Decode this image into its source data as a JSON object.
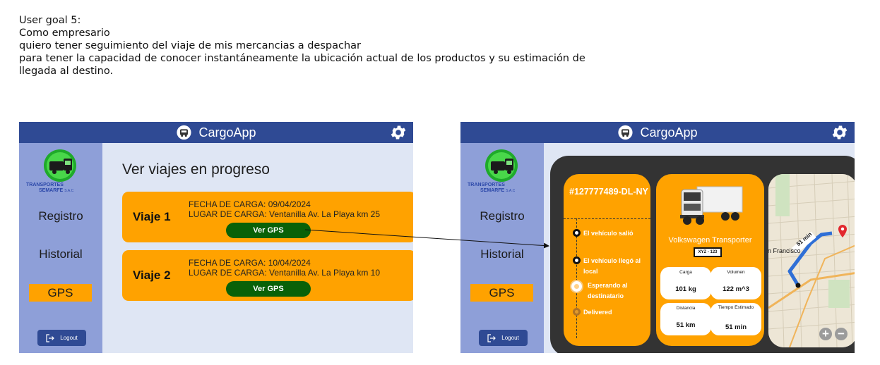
{
  "story": {
    "line1": "User goal 5:",
    "line2": "Como empresario",
    "line3": "quiero tener seguimiento del viaje de mis mercancias a despachar",
    "line4": "para tener la capacidad de conocer instantáneamente la ubicación actual de los productos y su estimación de",
    "line5": "llegada al destino."
  },
  "app": {
    "title": "CargoApp",
    "icon": "truck-icon",
    "settings_icon": "gear-icon"
  },
  "brand": {
    "name_top": "TRANSPORTES",
    "name_bottom": "SEMARFE",
    "suffix": "S.A.C"
  },
  "sidebar": {
    "items": [
      {
        "label": "Registro"
      },
      {
        "label": "Historial"
      },
      {
        "label": "GPS"
      }
    ],
    "logout_label": "Logout"
  },
  "list_screen": {
    "title": "Ver viajes en progreso",
    "trips": [
      {
        "name": "Viaje 1",
        "date_line": "FECHA DE CARGA: 09/04/2024",
        "place_line": "LUGAR DE CARGA: Ventanilla Av. La Playa km 25",
        "button": "Ver GPS"
      },
      {
        "name": "Viaje 2",
        "date_line": "FECHA DE CARGA: 10/04/2024",
        "place_line": "LUGAR DE CARGA: Ventanilla Av. La Playa km 10",
        "button": "Ver GPS"
      }
    ]
  },
  "detail_screen": {
    "trip_id": "#127777489-DL-NY",
    "steps": [
      {
        "label": "El vehículo salió",
        "state": "done"
      },
      {
        "label": "El vehículo llegó al local",
        "state": "done"
      },
      {
        "label": "Esperando al destinatario",
        "state": "current"
      },
      {
        "label": "Delivered",
        "state": "pending"
      }
    ],
    "vehicle": {
      "name": "Volkswagen Transporter",
      "plate": "XYZ - 123"
    },
    "stats": [
      {
        "label": "Carga",
        "value": "101 kg"
      },
      {
        "label": "Volumen",
        "value": "122 m^3"
      },
      {
        "label": "Distancia",
        "value": "51 km"
      },
      {
        "label": "Tiempo Estimado",
        "value": "51 min"
      }
    ],
    "map": {
      "eta_label": "51 min",
      "place_label": "an Francisco",
      "zoom_in": "+",
      "zoom_out": "−"
    }
  },
  "colors": {
    "header": "#2f4a94",
    "sidebar": "#8e9fd8",
    "accent": "#ffa200",
    "button": "#096108",
    "panel": "#333333"
  }
}
